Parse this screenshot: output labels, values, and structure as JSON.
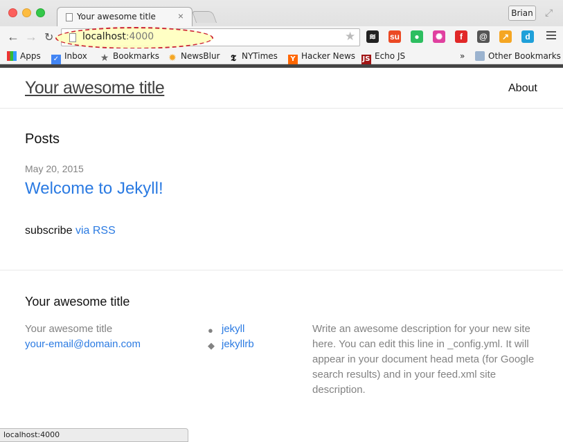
{
  "browser": {
    "tab_title": "Your awesome title",
    "tab_close": "×",
    "profile_name": "Brian",
    "url_host": "localhost",
    "url_port": ":4000",
    "status_url": "localhost:4000",
    "extensions": [
      {
        "name": "buffer-icon",
        "glyph": "≋",
        "color": "#222222"
      },
      {
        "name": "stumbleupon-icon",
        "glyph": "su",
        "color": "#eb4924"
      },
      {
        "name": "evernote-icon",
        "glyph": "●",
        "color": "#2dbe60"
      },
      {
        "name": "colorpicker-icon",
        "glyph": "✺",
        "color": "#e040a0"
      },
      {
        "name": "flipboard-icon",
        "glyph": "f",
        "color": "#e12828"
      },
      {
        "name": "at-icon",
        "glyph": "@",
        "color": "#555555"
      },
      {
        "name": "analytics-icon",
        "glyph": "↗",
        "color": "#f5a623"
      },
      {
        "name": "d-icon",
        "glyph": "d",
        "color": "#1fa0d9"
      }
    ]
  },
  "bookmarks": {
    "apps": "Apps",
    "inbox": "Inbox",
    "bookmarks": "Bookmarks",
    "newsblur": "NewsBlur",
    "nytimes": "NYTimes",
    "hackernews": "Hacker News",
    "echojs": "Echo JS",
    "overflow": "»",
    "other": "Other Bookmarks"
  },
  "site": {
    "title": "Your awesome title",
    "nav_about": "About",
    "posts_heading": "Posts",
    "post_date": "May 20, 2015",
    "post_title": "Welcome to Jekyll!",
    "subscribe_prefix": "subscribe",
    "subscribe_link": "via RSS"
  },
  "footer": {
    "heading": "Your awesome title",
    "name": "Your awesome title",
    "email": "your-email@domain.com",
    "github": "jekyll",
    "twitter": "jekyllrb",
    "description": "Write an awesome description for your new site here. You can edit this line in _config.yml. It will appear in your document head meta (for Google search results) and in your feed.xml site description."
  }
}
